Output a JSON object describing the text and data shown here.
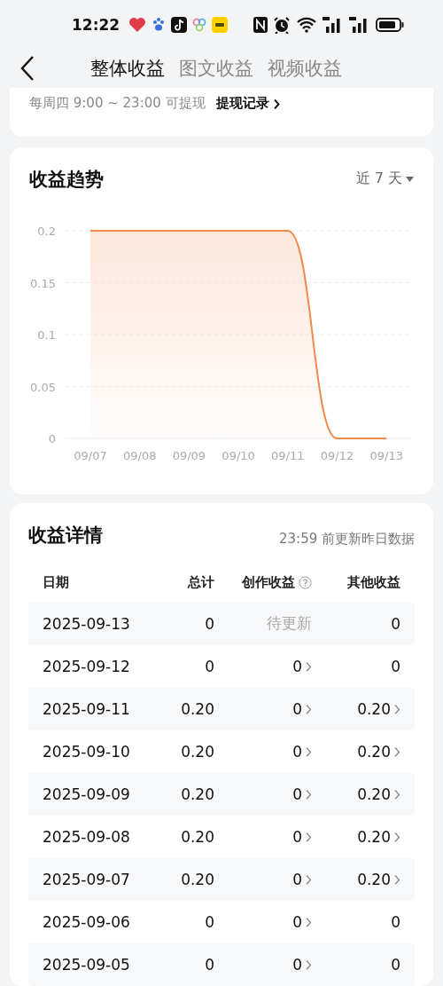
{
  "status_bar": {
    "time": "12:22"
  },
  "header": {
    "tabs": [
      {
        "label": "整体收益",
        "selected": true
      },
      {
        "label": "图文收益",
        "selected": false
      },
      {
        "label": "视频收益",
        "selected": false
      }
    ]
  },
  "withdraw_card": {
    "note": "每周四 9:00 ~ 23:00 可提现",
    "link": "提现记录"
  },
  "trend_card": {
    "title": "收益趋势",
    "range": "近 7 天",
    "chart_data": {
      "type": "area",
      "categories": [
        "09/07",
        "09/08",
        "09/09",
        "09/10",
        "09/11",
        "09/12",
        "09/13"
      ],
      "grid": true,
      "series": [
        {
          "color": "#f0894a",
          "values": [
            0.2,
            0.2,
            0.2,
            0.2,
            0.2,
            0,
            0
          ]
        }
      ],
      "ylim": [
        0,
        0.2
      ],
      "yticks": [
        0,
        {
          "value": 0.05,
          "label": "0.05"
        },
        {
          "value": 0.1,
          "label": "0.1"
        },
        {
          "value": 0.15,
          "label": "0.15"
        },
        {
          "value": 0.2,
          "label": "0.2"
        }
      ]
    }
  },
  "detail_card": {
    "title": "收益详情",
    "note": "23:59 前更新昨日数据",
    "columns": [
      "日期",
      "总计",
      "创作收益",
      "其他收益"
    ],
    "rows": [
      {
        "date": "2025-09-13",
        "total": "0",
        "creation": {
          "kind": "pending",
          "text": "待更新",
          "has_detail": false
        },
        "other": {
          "text": "0",
          "has_detail": false
        }
      },
      {
        "date": "2025-09-12",
        "total": "0",
        "creation": {
          "kind": "value",
          "text": "0",
          "has_detail": true
        },
        "other": {
          "text": "0",
          "has_detail": false
        }
      },
      {
        "date": "2025-09-11",
        "total": "0.20",
        "creation": {
          "kind": "value",
          "text": "0",
          "has_detail": true
        },
        "other": {
          "text": "0.20",
          "has_detail": true
        }
      },
      {
        "date": "2025-09-10",
        "total": "0.20",
        "creation": {
          "kind": "value",
          "text": "0",
          "has_detail": true
        },
        "other": {
          "text": "0.20",
          "has_detail": true
        }
      },
      {
        "date": "2025-09-09",
        "total": "0.20",
        "creation": {
          "kind": "value",
          "text": "0",
          "has_detail": true
        },
        "other": {
          "text": "0.20",
          "has_detail": true
        }
      },
      {
        "date": "2025-09-08",
        "total": "0.20",
        "creation": {
          "kind": "value",
          "text": "0",
          "has_detail": true
        },
        "other": {
          "text": "0.20",
          "has_detail": true
        }
      },
      {
        "date": "2025-09-07",
        "total": "0.20",
        "creation": {
          "kind": "value",
          "text": "0",
          "has_detail": true
        },
        "other": {
          "text": "0.20",
          "has_detail": true
        }
      },
      {
        "date": "2025-09-06",
        "total": "0",
        "creation": {
          "kind": "value",
          "text": "0",
          "has_detail": true
        },
        "other": {
          "text": "0",
          "has_detail": false
        }
      },
      {
        "date": "2025-09-05",
        "total": "0",
        "creation": {
          "kind": "value",
          "text": "0",
          "has_detail": true
        },
        "other": {
          "text": "0",
          "has_detail": false
        }
      }
    ]
  }
}
